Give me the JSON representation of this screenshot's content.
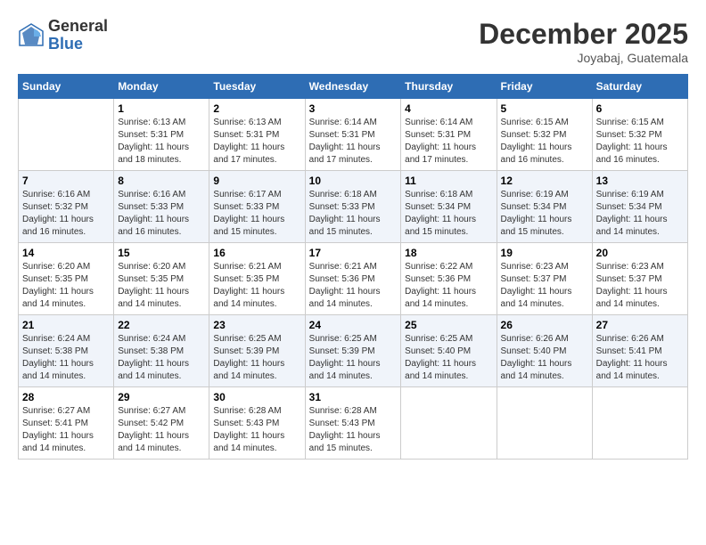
{
  "header": {
    "logo_general": "General",
    "logo_blue": "Blue",
    "month_title": "December 2025",
    "location": "Joyabaj, Guatemala"
  },
  "days_of_week": [
    "Sunday",
    "Monday",
    "Tuesday",
    "Wednesday",
    "Thursday",
    "Friday",
    "Saturday"
  ],
  "weeks": [
    [
      {
        "day": "",
        "info": ""
      },
      {
        "day": "1",
        "info": "Sunrise: 6:13 AM\nSunset: 5:31 PM\nDaylight: 11 hours and 18 minutes."
      },
      {
        "day": "2",
        "info": "Sunrise: 6:13 AM\nSunset: 5:31 PM\nDaylight: 11 hours and 17 minutes."
      },
      {
        "day": "3",
        "info": "Sunrise: 6:14 AM\nSunset: 5:31 PM\nDaylight: 11 hours and 17 minutes."
      },
      {
        "day": "4",
        "info": "Sunrise: 6:14 AM\nSunset: 5:31 PM\nDaylight: 11 hours and 17 minutes."
      },
      {
        "day": "5",
        "info": "Sunrise: 6:15 AM\nSunset: 5:32 PM\nDaylight: 11 hours and 16 minutes."
      },
      {
        "day": "6",
        "info": "Sunrise: 6:15 AM\nSunset: 5:32 PM\nDaylight: 11 hours and 16 minutes."
      }
    ],
    [
      {
        "day": "7",
        "info": "Sunrise: 6:16 AM\nSunset: 5:32 PM\nDaylight: 11 hours and 16 minutes."
      },
      {
        "day": "8",
        "info": "Sunrise: 6:16 AM\nSunset: 5:33 PM\nDaylight: 11 hours and 16 minutes."
      },
      {
        "day": "9",
        "info": "Sunrise: 6:17 AM\nSunset: 5:33 PM\nDaylight: 11 hours and 15 minutes."
      },
      {
        "day": "10",
        "info": "Sunrise: 6:18 AM\nSunset: 5:33 PM\nDaylight: 11 hours and 15 minutes."
      },
      {
        "day": "11",
        "info": "Sunrise: 6:18 AM\nSunset: 5:34 PM\nDaylight: 11 hours and 15 minutes."
      },
      {
        "day": "12",
        "info": "Sunrise: 6:19 AM\nSunset: 5:34 PM\nDaylight: 11 hours and 15 minutes."
      },
      {
        "day": "13",
        "info": "Sunrise: 6:19 AM\nSunset: 5:34 PM\nDaylight: 11 hours and 14 minutes."
      }
    ],
    [
      {
        "day": "14",
        "info": "Sunrise: 6:20 AM\nSunset: 5:35 PM\nDaylight: 11 hours and 14 minutes."
      },
      {
        "day": "15",
        "info": "Sunrise: 6:20 AM\nSunset: 5:35 PM\nDaylight: 11 hours and 14 minutes."
      },
      {
        "day": "16",
        "info": "Sunrise: 6:21 AM\nSunset: 5:35 PM\nDaylight: 11 hours and 14 minutes."
      },
      {
        "day": "17",
        "info": "Sunrise: 6:21 AM\nSunset: 5:36 PM\nDaylight: 11 hours and 14 minutes."
      },
      {
        "day": "18",
        "info": "Sunrise: 6:22 AM\nSunset: 5:36 PM\nDaylight: 11 hours and 14 minutes."
      },
      {
        "day": "19",
        "info": "Sunrise: 6:23 AM\nSunset: 5:37 PM\nDaylight: 11 hours and 14 minutes."
      },
      {
        "day": "20",
        "info": "Sunrise: 6:23 AM\nSunset: 5:37 PM\nDaylight: 11 hours and 14 minutes."
      }
    ],
    [
      {
        "day": "21",
        "info": "Sunrise: 6:24 AM\nSunset: 5:38 PM\nDaylight: 11 hours and 14 minutes."
      },
      {
        "day": "22",
        "info": "Sunrise: 6:24 AM\nSunset: 5:38 PM\nDaylight: 11 hours and 14 minutes."
      },
      {
        "day": "23",
        "info": "Sunrise: 6:25 AM\nSunset: 5:39 PM\nDaylight: 11 hours and 14 minutes."
      },
      {
        "day": "24",
        "info": "Sunrise: 6:25 AM\nSunset: 5:39 PM\nDaylight: 11 hours and 14 minutes."
      },
      {
        "day": "25",
        "info": "Sunrise: 6:25 AM\nSunset: 5:40 PM\nDaylight: 11 hours and 14 minutes."
      },
      {
        "day": "26",
        "info": "Sunrise: 6:26 AM\nSunset: 5:40 PM\nDaylight: 11 hours and 14 minutes."
      },
      {
        "day": "27",
        "info": "Sunrise: 6:26 AM\nSunset: 5:41 PM\nDaylight: 11 hours and 14 minutes."
      }
    ],
    [
      {
        "day": "28",
        "info": "Sunrise: 6:27 AM\nSunset: 5:41 PM\nDaylight: 11 hours and 14 minutes."
      },
      {
        "day": "29",
        "info": "Sunrise: 6:27 AM\nSunset: 5:42 PM\nDaylight: 11 hours and 14 minutes."
      },
      {
        "day": "30",
        "info": "Sunrise: 6:28 AM\nSunset: 5:43 PM\nDaylight: 11 hours and 14 minutes."
      },
      {
        "day": "31",
        "info": "Sunrise: 6:28 AM\nSunset: 5:43 PM\nDaylight: 11 hours and 15 minutes."
      },
      {
        "day": "",
        "info": ""
      },
      {
        "day": "",
        "info": ""
      },
      {
        "day": "",
        "info": ""
      }
    ]
  ]
}
